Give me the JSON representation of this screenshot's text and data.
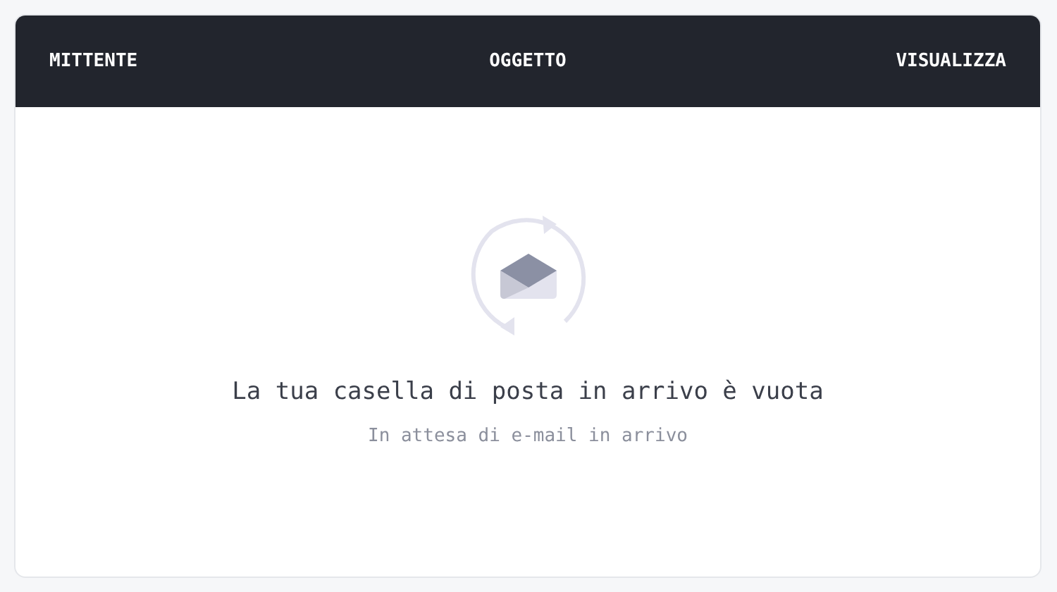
{
  "table": {
    "columns": [
      "MITTENTE",
      "OGGETTO",
      "VISUALIZZA"
    ]
  },
  "empty_state": {
    "title": "La tua casella di posta in arrivo è vuota",
    "subtitle": "In attesa di e-mail in arrivo"
  }
}
